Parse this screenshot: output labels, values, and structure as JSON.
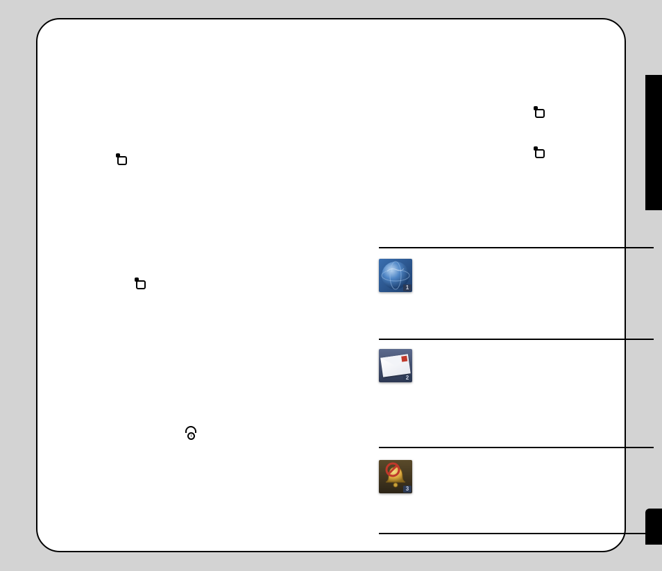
{
  "decorations": {
    "notch_icons": [
      {
        "id": "left-1"
      },
      {
        "id": "left-2"
      },
      {
        "id": "right-1"
      },
      {
        "id": "right-2"
      }
    ],
    "phone_icon": {
      "id": "phone-info"
    }
  },
  "right_column": {
    "items": [
      {
        "id": "globe",
        "badge": "1",
        "icon": "globe-icon",
        "label": ""
      },
      {
        "id": "envelope",
        "badge": "2",
        "icon": "envelope-icon",
        "label": ""
      },
      {
        "id": "bell",
        "badge": "3",
        "icon": "bell-no-icon",
        "label": ""
      }
    ]
  }
}
